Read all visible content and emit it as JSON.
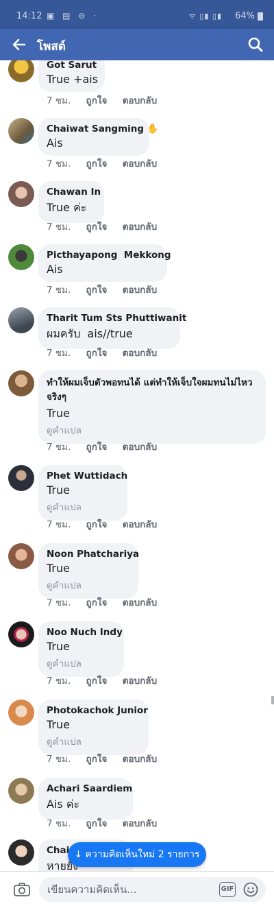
{
  "status_bar": {
    "time": "14:12",
    "battery": "64%"
  },
  "nav": {
    "title": "โพสต์"
  },
  "comments": [
    {
      "author": "Got Sarut",
      "text": "True +ais",
      "time": "7 ชม.",
      "like": "ถูกใจ",
      "reply": "ตอบกลับ"
    },
    {
      "author": "Chaiwat Sangming",
      "text": "Ais",
      "time": "7 ชม.",
      "like": "ถูกใจ",
      "reply": "ตอบกลับ"
    },
    {
      "author": "Chawan In",
      "text": "True ค่ะ",
      "time": "7 ชม.",
      "like": "ถูกใจ",
      "reply": "ตอบกลับ"
    },
    {
      "author": "Picthayapong  Mekkong",
      "text": "Ais",
      "time": "7 ชม.",
      "like": "ถูกใจ",
      "reply": "ตอบกลับ"
    },
    {
      "author": "Tharit Tum Sts Phuttiwanit",
      "text": "ผมครับ  ais//true",
      "time": "7 ชม.",
      "like": "ถูกใจ",
      "reply": "ตอบกลับ"
    },
    {
      "author": "ทำให้ผมเจ็บตัวพอทนได้ แต่ทำให้เจ็บใจผมทนไม่ไหวจริงๆ",
      "text": "True",
      "translate": "ดูคำแปล",
      "time": "7 ชม.",
      "like": "ถูกใจ",
      "reply": "ตอบกลับ"
    },
    {
      "author": "Phet Wuttidach",
      "text": "True",
      "translate": "ดูคำแปล",
      "time": "7 ชม.",
      "like": "ถูกใจ",
      "reply": "ตอบกลับ"
    },
    {
      "author": "Noon Phatchariya",
      "text": "True",
      "translate": "ดูคำแปล",
      "time": "7 ชม.",
      "like": "ถูกใจ",
      "reply": "ตอบกลับ"
    },
    {
      "author": "Noo Nuch Indy",
      "text": "True",
      "translate": "ดูคำแปล",
      "time": "7 ชม.",
      "like": "ถูกใจ",
      "reply": "ตอบกลับ"
    },
    {
      "author": "Photokachok Junior",
      "text": "True",
      "translate": "ดูคำแปล",
      "time": "7 ชม.",
      "like": "ถูกใจ",
      "reply": "ตอบกลับ"
    },
    {
      "author": "Achari Saardiem",
      "text": "Ais ค่ะ",
      "time": "7 ชม.",
      "like": "ถูกใจ",
      "reply": "ตอบกลับ"
    },
    {
      "author": "Chai",
      "text": "หายยัง",
      "time": "",
      "like": "",
      "reply": ""
    }
  ],
  "new_comments_pill": "↓ ความคิดเห็นใหม่ 2 รายการ",
  "composer": {
    "placeholder": "เขียนความคิดเห็น...",
    "gif_label": "GIF"
  },
  "colors": {
    "header": "#4267b2",
    "status_bar": "#365899",
    "bubble": "#f0f2f5",
    "pill": "#1877f2"
  }
}
